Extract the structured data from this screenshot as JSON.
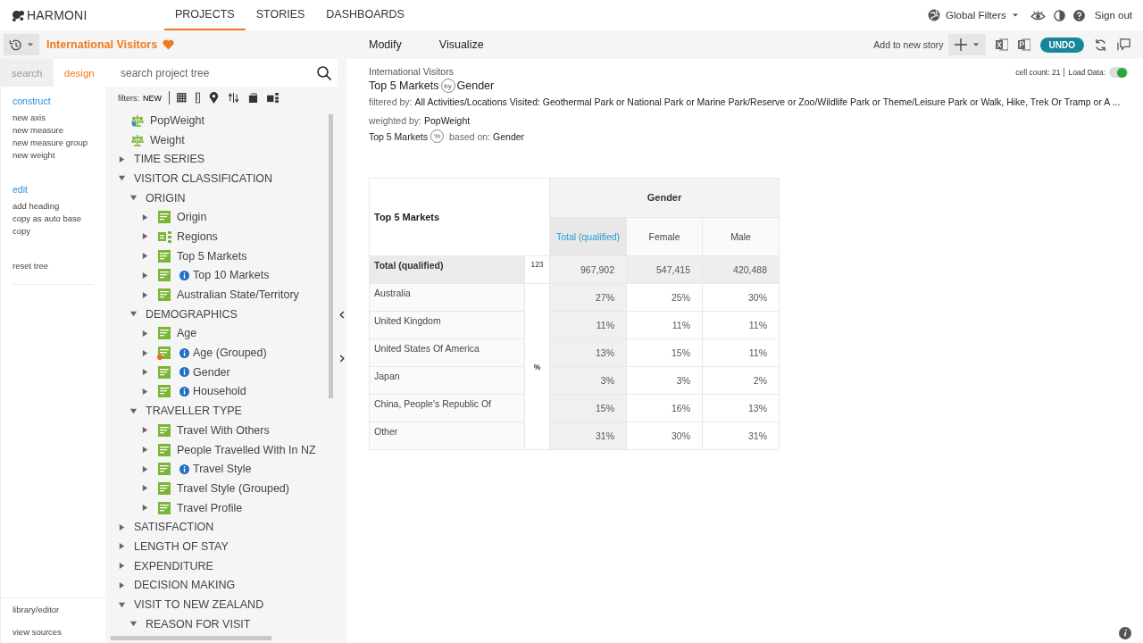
{
  "brand": "HARMONI",
  "nav": [
    {
      "label": "PROJECTS",
      "selected": true
    },
    {
      "label": "STORIES",
      "selected": false
    },
    {
      "label": "DASHBOARDS",
      "selected": false
    }
  ],
  "global_filters": "Global Filters",
  "sign_out": "Sign out",
  "project": {
    "title": "International Visitors",
    "favorite": true
  },
  "side_tabs": [
    {
      "label": "search",
      "selected": false
    },
    {
      "label": "design",
      "selected": true
    }
  ],
  "side_menu": [
    {
      "kind": "heading",
      "label": "construct"
    },
    {
      "kind": "item",
      "label": "new axis"
    },
    {
      "kind": "item",
      "label": "new measure"
    },
    {
      "kind": "item",
      "label": "new measure group"
    },
    {
      "kind": "item",
      "label": "new weight"
    },
    {
      "kind": "heading",
      "label": "edit"
    },
    {
      "kind": "item",
      "label": "add heading"
    },
    {
      "kind": "item",
      "label": "copy as auto base"
    },
    {
      "kind": "item",
      "label": "copy"
    },
    {
      "kind": "spacer-item",
      "label": "reset tree"
    }
  ],
  "side_footer": [
    "library/editor",
    "view sources"
  ],
  "tree_search": {
    "placeholder": "search project tree"
  },
  "filters": {
    "label": "filters:",
    "new": "NEW"
  },
  "tree": [
    {
      "kind": "weight",
      "label": "PopWeight",
      "flagged": true
    },
    {
      "kind": "weight",
      "label": "Weight",
      "flagged": false
    },
    {
      "kind": "folder",
      "label": "TIME SERIES",
      "expanded": false
    },
    {
      "kind": "folder",
      "label": "VISITOR CLASSIFICATION",
      "expanded": true,
      "children": [
        {
          "kind": "folder",
          "label": "ORIGIN",
          "expanded": true,
          "children": [
            {
              "kind": "variable",
              "label": "Origin",
              "info": false,
              "flagged": false
            },
            {
              "kind": "group-variable",
              "label": "Regions",
              "info": false,
              "flagged": false
            },
            {
              "kind": "variable",
              "label": "Top 5 Markets",
              "info": false,
              "flagged": false
            },
            {
              "kind": "variable",
              "label": "Top 10 Markets",
              "info": true,
              "flagged": false
            },
            {
              "kind": "variable",
              "label": "Australian State/Territory",
              "info": false,
              "flagged": false
            }
          ]
        },
        {
          "kind": "folder",
          "label": "DEMOGRAPHICS",
          "expanded": true,
          "children": [
            {
              "kind": "variable",
              "label": "Age",
              "info": false,
              "flagged": false
            },
            {
              "kind": "variable",
              "label": "Age (Grouped)",
              "info": true,
              "flagged": true
            },
            {
              "kind": "variable",
              "label": "Gender",
              "info": true,
              "flagged": false
            },
            {
              "kind": "variable",
              "label": "Household",
              "info": true,
              "flagged": false
            }
          ]
        },
        {
          "kind": "folder",
          "label": "TRAVELLER TYPE",
          "expanded": true,
          "children": [
            {
              "kind": "variable",
              "label": "Travel With Others",
              "info": false,
              "flagged": false
            },
            {
              "kind": "variable",
              "label": "People Travelled With In NZ",
              "info": false,
              "flagged": false
            },
            {
              "kind": "variable",
              "label": "Travel Style",
              "info": true,
              "flagged": false
            },
            {
              "kind": "variable",
              "label": "Travel Style (Grouped)",
              "info": false,
              "flagged": false
            },
            {
              "kind": "variable",
              "label": "Travel Profile",
              "info": false,
              "flagged": false
            }
          ]
        }
      ]
    },
    {
      "kind": "folder",
      "label": "SATISFACTION",
      "expanded": false
    },
    {
      "kind": "folder",
      "label": "LENGTH OF STAY",
      "expanded": false
    },
    {
      "kind": "folder",
      "label": "EXPENDITURE",
      "expanded": false
    },
    {
      "kind": "folder",
      "label": "DECISION MAKING",
      "expanded": false
    },
    {
      "kind": "folder",
      "label": "VISIT TO NEW ZEALAND",
      "expanded": true,
      "children": [
        {
          "kind": "folder",
          "label": "REASON FOR VISIT",
          "expanded": true
        }
      ]
    }
  ],
  "toolbar": {
    "tabs": [
      "Modify",
      "Visualize"
    ],
    "add_to_story": "Add to new story",
    "undo": "UNDO"
  },
  "report": {
    "project": "International Visitors",
    "row_var": "Top 5 Markets",
    "by": "by",
    "col_var": "Gender",
    "filter_label": "filtered by:",
    "filter_value": "All Activities/Locations Visited: Geothermal Park or National Park or Marine Park/Reserve or Zoo/Wildlife Park or Theme/Leisure Park or Walk, Hike, Trek Or Tramp or A ...",
    "weight_label": "weighted by:",
    "weight_value": "PopWeight",
    "base_var": "Top 5 Markets",
    "base_symbol": "%",
    "base_label": "based on:",
    "base_value": "Gender",
    "cell_count": "cell count: 21",
    "load_data": "Load Data:",
    "load_data_on": true
  },
  "table": {
    "corner": "Top 5 Markets",
    "group": "Gender",
    "columns": [
      {
        "label": "Total (qualified)",
        "selected": true
      },
      {
        "label": "Female",
        "selected": false
      },
      {
        "label": "Male",
        "selected": false
      }
    ],
    "base_stat": "123",
    "pct_stat": "%",
    "rows": [
      {
        "kind": "total",
        "label": "Total (qualified)",
        "values": [
          "967,902",
          "547,415",
          "420,488"
        ]
      },
      {
        "kind": "data",
        "label": "Australia",
        "values": [
          "27%",
          "25%",
          "30%"
        ]
      },
      {
        "kind": "data",
        "label": "United Kingdom",
        "values": [
          "11%",
          "11%",
          "11%"
        ]
      },
      {
        "kind": "data",
        "label": "United States Of America",
        "values": [
          "13%",
          "15%",
          "11%"
        ]
      },
      {
        "kind": "data",
        "label": "Japan",
        "values": [
          "3%",
          "3%",
          "2%"
        ]
      },
      {
        "kind": "data",
        "label": "China, People's Republic Of",
        "values": [
          "15%",
          "16%",
          "13%"
        ]
      },
      {
        "kind": "data",
        "label": "Other",
        "values": [
          "31%",
          "30%",
          "31%"
        ]
      }
    ]
  }
}
